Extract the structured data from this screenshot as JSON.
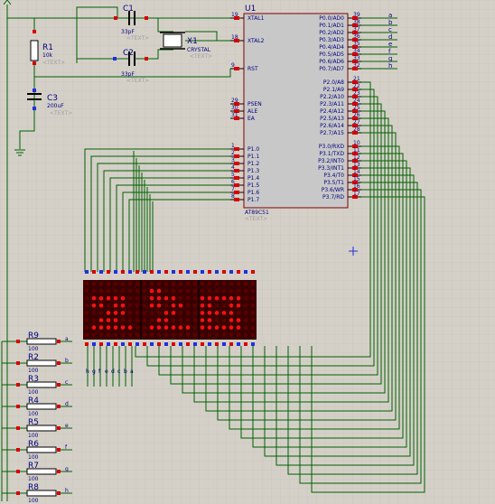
{
  "components": {
    "c1": {
      "ref": "C1",
      "value": "33pF",
      "text": "<TEXT>"
    },
    "c2": {
      "ref": "C2",
      "value": "33pF",
      "text": "<TEXT>"
    },
    "c3": {
      "ref": "C3",
      "value": "200uF",
      "text": "<TEXT>"
    },
    "r1": {
      "ref": "R1",
      "value": "10k",
      "text": "<TEXT>"
    },
    "x1": {
      "ref": "X1",
      "value": "CRYSTAL",
      "text": "<TEXT>"
    },
    "u1": {
      "ref": "U1",
      "part": "AT89C51",
      "text": "<TEXT>"
    }
  },
  "u1_left_pins": [
    {
      "num": "19",
      "name": "XTAL1"
    },
    {
      "num": "18",
      "name": "XTAL2"
    },
    {
      "num": "9",
      "name": "RST"
    },
    {
      "num": "29",
      "name": "PSEN"
    },
    {
      "num": "30",
      "name": "ALE"
    },
    {
      "num": "31",
      "name": "EA"
    },
    {
      "num": "1",
      "name": "P1.0"
    },
    {
      "num": "2",
      "name": "P1.1"
    },
    {
      "num": "3",
      "name": "P1.2"
    },
    {
      "num": "4",
      "name": "P1.3"
    },
    {
      "num": "5",
      "name": "P1.4"
    },
    {
      "num": "6",
      "name": "P1.5"
    },
    {
      "num": "7",
      "name": "P1.6"
    },
    {
      "num": "8",
      "name": "P1.7"
    }
  ],
  "u1_right_pins": [
    {
      "num": "39",
      "name": "P0.0/AD0",
      "net": "a"
    },
    {
      "num": "38",
      "name": "P0.1/AD1",
      "net": "b"
    },
    {
      "num": "37",
      "name": "P0.2/AD2",
      "net": "c"
    },
    {
      "num": "36",
      "name": "P0.3/AD3",
      "net": "d"
    },
    {
      "num": "35",
      "name": "P0.4/AD4",
      "net": "e"
    },
    {
      "num": "34",
      "name": "P0.5/AD5",
      "net": "f"
    },
    {
      "num": "33",
      "name": "P0.6/AD6",
      "net": "g"
    },
    {
      "num": "32",
      "name": "P0.7/AD7",
      "net": "h"
    },
    {
      "num": "21",
      "name": "P2.0/A8"
    },
    {
      "num": "22",
      "name": "P2.1/A9"
    },
    {
      "num": "23",
      "name": "P2.2/A10"
    },
    {
      "num": "24",
      "name": "P2.3/A11"
    },
    {
      "num": "25",
      "name": "P2.4/A12"
    },
    {
      "num": "26",
      "name": "P2.5/A13"
    },
    {
      "num": "27",
      "name": "P2.6/A14"
    },
    {
      "num": "28",
      "name": "P2.7/A15"
    },
    {
      "num": "10",
      "name": "P3.0/RXD"
    },
    {
      "num": "11",
      "name": "P3.1/TXD"
    },
    {
      "num": "12",
      "name": "P3.2/INT0"
    },
    {
      "num": "13",
      "name": "P3.3/INT1"
    },
    {
      "num": "14",
      "name": "P3.4/T0"
    },
    {
      "num": "15",
      "name": "P3.5/T1"
    },
    {
      "num": "16",
      "name": "P3.6/WR"
    },
    {
      "num": "17",
      "name": "P3.7/RD"
    }
  ],
  "resistors": [
    {
      "ref": "R9",
      "value": "100",
      "net": "a"
    },
    {
      "ref": "R2",
      "value": "100",
      "net": "b"
    },
    {
      "ref": "R3",
      "value": "100",
      "net": "c"
    },
    {
      "ref": "R4",
      "value": "100",
      "net": "d"
    },
    {
      "ref": "R5",
      "value": "100",
      "net": "e"
    },
    {
      "ref": "R6",
      "value": "100",
      "net": "f"
    },
    {
      "ref": "R7",
      "value": "100",
      "net": "g"
    },
    {
      "ref": "R8",
      "value": "100",
      "net": "h"
    }
  ],
  "matrix_bottom_labels": [
    "h",
    "g",
    "f",
    "e",
    "d",
    "c",
    "b",
    "a"
  ],
  "colors": {
    "background": "#d4d0c8",
    "grid": "#c4c0b8",
    "wire": "#006000",
    "chip_body": "#c8c8c8",
    "chip_border": "#800000",
    "pin_red": "#d80000",
    "pin_blue": "#2030e0",
    "led_on": "#ff1010",
    "led_off": "#5a0000",
    "matrix_bg": "#3a0000",
    "text": "#000080",
    "placeholder": "#a0a0a0"
  }
}
